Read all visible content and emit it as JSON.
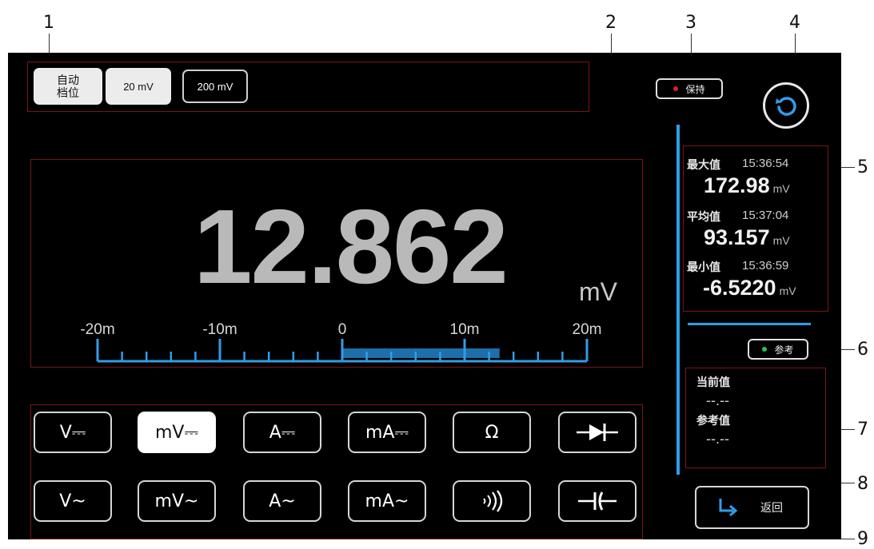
{
  "callouts": [
    "1",
    "2",
    "3",
    "4",
    "5",
    "6",
    "7",
    "8",
    "9"
  ],
  "range_bar": {
    "auto_label_line1": "自动",
    "auto_label_line2": "档位",
    "options": [
      "20 mV",
      "200 mV"
    ],
    "selected_index": 0
  },
  "reading": {
    "value": "12.862",
    "unit": "mV"
  },
  "scale": {
    "labels": [
      "-20m",
      "-10m",
      "0",
      "10m",
      "20m"
    ],
    "fill_fraction": 0.643
  },
  "hold_button": {
    "label": "保持",
    "indicator_color": "#e02020"
  },
  "reset_button": {
    "icon": "refresh-icon"
  },
  "stats": {
    "max": {
      "label": "最大值",
      "time": "15:36:54",
      "value": "172.98",
      "unit": "mV"
    },
    "avg": {
      "label": "平均值",
      "time": "15:37:04",
      "value": "93.157",
      "unit": "mV"
    },
    "min": {
      "label": "最小值",
      "time": "15:36:59",
      "value": "-6.5220",
      "unit": "mV"
    }
  },
  "reference_button": {
    "label": "参考",
    "indicator_color": "#2ec04a"
  },
  "reference": {
    "current_label": "当前值",
    "current_value": "--.--",
    "ref_label": "参考值",
    "ref_value": "--.--"
  },
  "functions": {
    "row1": [
      "V⎓",
      "mV⎓",
      "A⎓",
      "mA⎓",
      "Ω",
      "diode-icon"
    ],
    "row2": [
      "V~",
      "mV~",
      "A~",
      "mA~",
      "continuity-icon",
      "capacitor-icon"
    ],
    "selected": "mV⎓"
  },
  "back_button": {
    "label": "返回",
    "icon": "return-arrow-icon"
  },
  "colors": {
    "accent": "#2f9ee8",
    "frame": "#7a1515",
    "background": "#000000"
  }
}
